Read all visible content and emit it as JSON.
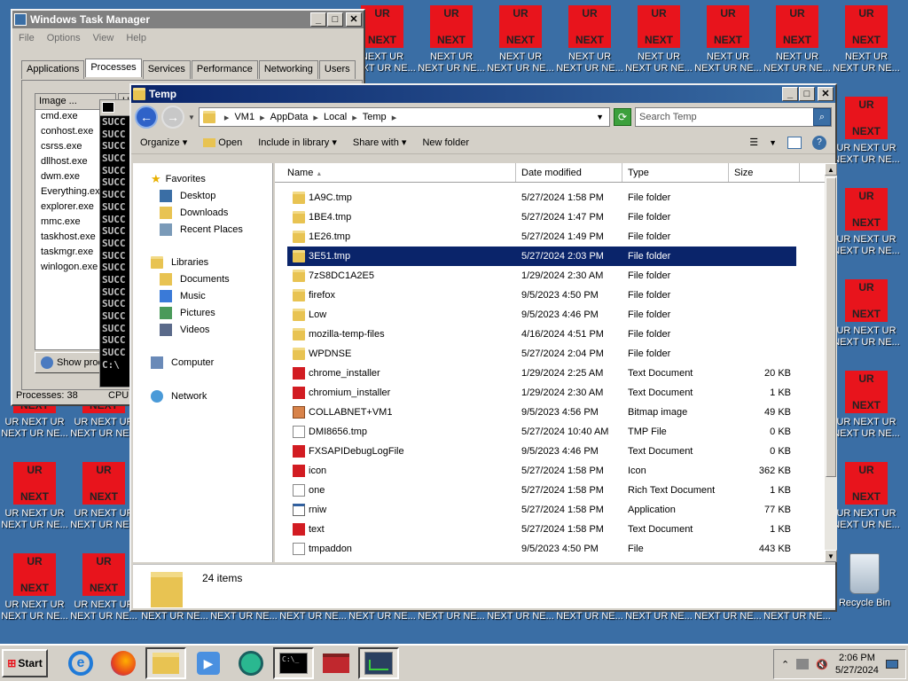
{
  "desktop": {
    "ur_text": "UR",
    "next_text": "NEXT",
    "label_top_a": "NEXT UR",
    "label_top_b": "NEXT UR NE...",
    "label_side_a": "UR NEXT UR",
    "label_side_b": "NEXT UR NE...",
    "label_bottom_strip": "NEXT UR NE...",
    "recycle_label": "Recycle Bin"
  },
  "task_manager": {
    "title": "Windows Task Manager",
    "menu": [
      "File",
      "Options",
      "View",
      "Help"
    ],
    "tabs": [
      "Applications",
      "Processes",
      "Services",
      "Performance",
      "Networking",
      "Users"
    ],
    "selected_tab": "Processes",
    "col_image": "Image ...",
    "col_user": "Us",
    "processes": [
      "cmd.exe",
      "conhost.exe",
      "csrss.exe",
      "dllhost.exe",
      "dwm.exe",
      "Everything.ex",
      "explorer.exe",
      "mmc.exe",
      "taskhost.exe",
      "taskmgr.exe",
      "winlogon.exe"
    ],
    "show_button": "Show proc",
    "status": "Processes: 38",
    "cpu_label": "CPU"
  },
  "cmd": {
    "lines": [
      "SUCC",
      "SUCC",
      "SUCC",
      "SUCC",
      "SUCC",
      "SUCC",
      "SUCC",
      "SUCC",
      "SUCC",
      "SUCC",
      "SUCC",
      "SUCC",
      "SUCC",
      "SUCC",
      "SUCC",
      "SUCC",
      "SUCC",
      "SUCC",
      "SUCC",
      "SUCC",
      "C:\\"
    ]
  },
  "explorer": {
    "title": "Temp",
    "breadcrumb": [
      "VM1",
      "AppData",
      "Local",
      "Temp"
    ],
    "search_placeholder": "Search Temp",
    "commands": [
      "Organize",
      "Open",
      "Include in library",
      "Share with",
      "New folder"
    ],
    "nav": {
      "favorites": "Favorites",
      "fav_items": [
        "Desktop",
        "Downloads",
        "Recent Places"
      ],
      "libraries": "Libraries",
      "lib_items": [
        "Documents",
        "Music",
        "Pictures",
        "Videos"
      ],
      "computer": "Computer",
      "network": "Network"
    },
    "columns": [
      "Name",
      "Date modified",
      "Type",
      "Size"
    ],
    "files": [
      {
        "name": "1A9C.tmp",
        "date": "5/27/2024 1:58 PM",
        "type": "File folder",
        "size": "",
        "icon": "folder"
      },
      {
        "name": "1BE4.tmp",
        "date": "5/27/2024 1:47 PM",
        "type": "File folder",
        "size": "",
        "icon": "folder"
      },
      {
        "name": "1E26.tmp",
        "date": "5/27/2024 1:49 PM",
        "type": "File folder",
        "size": "",
        "icon": "folder"
      },
      {
        "name": "3E51.tmp",
        "date": "5/27/2024 2:03 PM",
        "type": "File folder",
        "size": "",
        "icon": "folder",
        "selected": true
      },
      {
        "name": "7zS8DC1A2E5",
        "date": "1/29/2024 2:30 AM",
        "type": "File folder",
        "size": "",
        "icon": "folder"
      },
      {
        "name": "firefox",
        "date": "9/5/2023 4:50 PM",
        "type": "File folder",
        "size": "",
        "icon": "folder"
      },
      {
        "name": "Low",
        "date": "9/5/2023 4:46 PM",
        "type": "File folder",
        "size": "",
        "icon": "folder"
      },
      {
        "name": "mozilla-temp-files",
        "date": "4/16/2024 4:51 PM",
        "type": "File folder",
        "size": "",
        "icon": "folder"
      },
      {
        "name": "WPDNSE",
        "date": "5/27/2024 2:04 PM",
        "type": "File folder",
        "size": "",
        "icon": "folder"
      },
      {
        "name": "chrome_installer",
        "date": "1/29/2024 2:25 AM",
        "type": "Text Document",
        "size": "20 KB",
        "icon": "red"
      },
      {
        "name": "chromium_installer",
        "date": "1/29/2024 2:30 AM",
        "type": "Text Document",
        "size": "1 KB",
        "icon": "red"
      },
      {
        "name": "COLLABNET+VM1",
        "date": "9/5/2023 4:56 PM",
        "type": "Bitmap image",
        "size": "49 KB",
        "icon": "img"
      },
      {
        "name": "DMI8656.tmp",
        "date": "5/27/2024 10:40 AM",
        "type": "TMP File",
        "size": "0 KB",
        "icon": "doc"
      },
      {
        "name": "FXSAPIDebugLogFile",
        "date": "9/5/2023 4:46 PM",
        "type": "Text Document",
        "size": "0 KB",
        "icon": "red"
      },
      {
        "name": "icon",
        "date": "5/27/2024 1:58 PM",
        "type": "Icon",
        "size": "362 KB",
        "icon": "red"
      },
      {
        "name": "one",
        "date": "5/27/2024 1:58 PM",
        "type": "Rich Text Document",
        "size": "1 KB",
        "icon": "doc"
      },
      {
        "name": "rniw",
        "date": "5/27/2024 1:58 PM",
        "type": "Application",
        "size": "77 KB",
        "icon": "app"
      },
      {
        "name": "text",
        "date": "5/27/2024 1:58 PM",
        "type": "Text Document",
        "size": "1 KB",
        "icon": "red"
      },
      {
        "name": "tmpaddon",
        "date": "9/5/2023 4:50 PM",
        "type": "File",
        "size": "443 KB",
        "icon": "doc"
      }
    ],
    "item_count": "24 items"
  },
  "taskbar": {
    "start": "Start",
    "time": "2:06 PM",
    "date": "5/27/2024"
  }
}
